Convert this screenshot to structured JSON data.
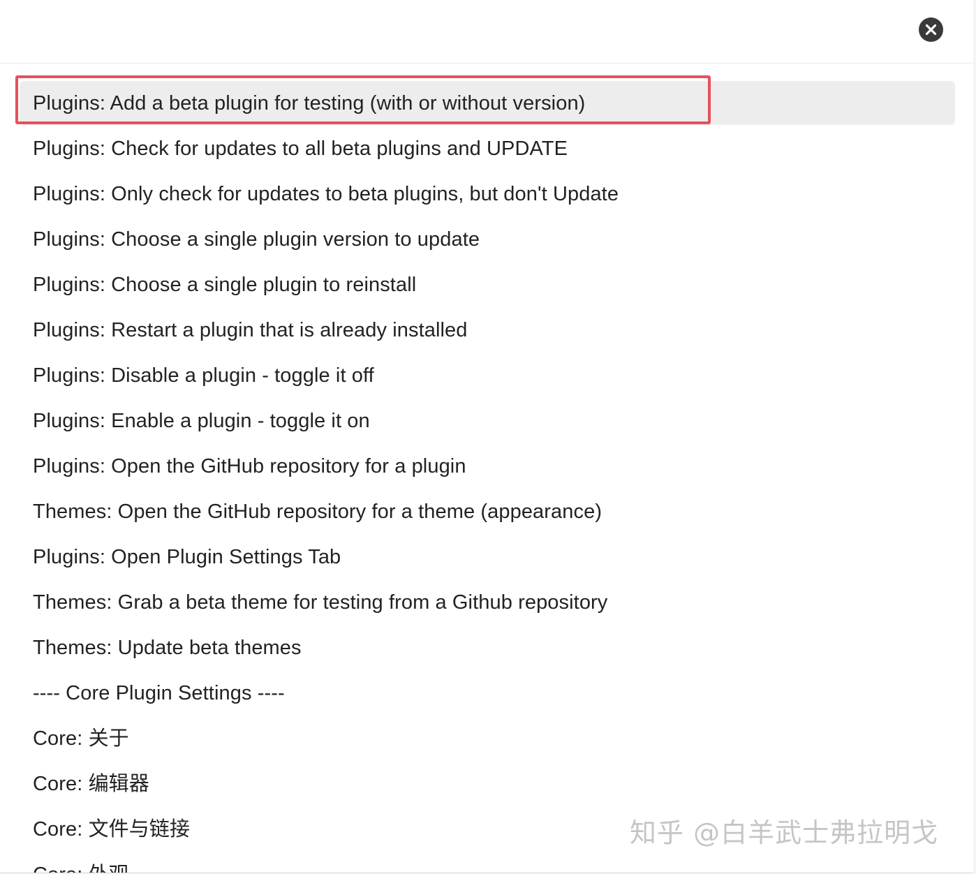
{
  "dialog": {
    "close_icon": "close-circle-icon",
    "colors": {
      "close_button_bg": "#3a3a3c",
      "selected_row_bg": "#ededed",
      "highlight_border": "#e8505b",
      "text": "#222222"
    }
  },
  "commands": [
    {
      "label": "Plugins: Add a beta plugin for testing (with or without version)",
      "selected": true
    },
    {
      "label": "Plugins: Check for updates to all beta plugins and UPDATE"
    },
    {
      "label": "Plugins: Only check for updates to beta plugins, but don't Update"
    },
    {
      "label": "Plugins: Choose a single plugin version to update"
    },
    {
      "label": "Plugins: Choose a single plugin to reinstall"
    },
    {
      "label": "Plugins: Restart a plugin that is already installed"
    },
    {
      "label": "Plugins: Disable a plugin - toggle it off"
    },
    {
      "label": "Plugins: Enable a plugin - toggle it on"
    },
    {
      "label": "Plugins: Open the GitHub repository for a plugin"
    },
    {
      "label": "Themes: Open the GitHub repository for a theme (appearance)"
    },
    {
      "label": "Plugins: Open Plugin Settings Tab"
    },
    {
      "label": "Themes: Grab a beta theme for testing from a Github repository"
    },
    {
      "label": "Themes: Update beta themes"
    },
    {
      "label": "---- Core Plugin Settings ----"
    },
    {
      "label": "Core: 关于"
    },
    {
      "label": "Core: 编辑器"
    },
    {
      "label": "Core: 文件与链接"
    },
    {
      "label": "Core: 外观"
    }
  ],
  "watermark": "知乎 @白羊武士弗拉明戈"
}
